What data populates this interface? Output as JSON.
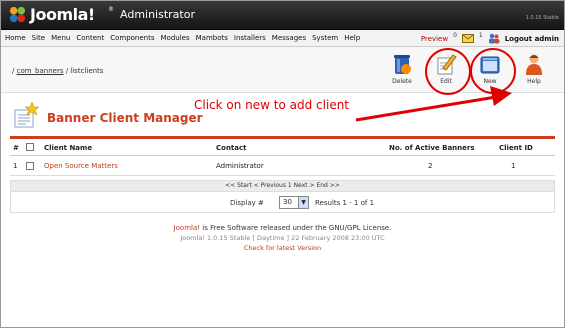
{
  "header": {
    "logo": "Joomla!",
    "logo_tm": "®",
    "title": "Administrator",
    "version": "1.0.15 Stable"
  },
  "menu": [
    "Home",
    "Site",
    "Menu",
    "Content",
    "Components",
    "Modules",
    "Mambots",
    "Installers",
    "Messages",
    "System",
    "Help"
  ],
  "status": {
    "preview": "Preview",
    "messages_count": "0",
    "users_count": "1",
    "logout": "Logout admin"
  },
  "breadcrumb": {
    "prefix": "/ ",
    "link": "com_banners",
    "rest": " / listclients"
  },
  "toolbar": {
    "delete": "Delete",
    "edit": "Edit",
    "new": "New",
    "help": "Help"
  },
  "page": {
    "title": "Banner Client Manager",
    "annotation": "Click on new to add client"
  },
  "table": {
    "headers": {
      "num": "#",
      "name": "Client Name",
      "contact": "Contact",
      "banners": "No. of Active Banners",
      "client_id": "Client ID"
    },
    "rows": [
      {
        "num": "1",
        "name": "Open Source Matters",
        "contact": "Administrator",
        "banners": "2",
        "client_id": "1"
      }
    ]
  },
  "pagination": {
    "nav": "<< Start < Previous 1 Next > End >>",
    "display_label": "Display #",
    "display_value": "30",
    "results": "Results 1 - 1 of 1"
  },
  "footer": {
    "joomla_link": "Joomla!",
    "license_text": " is Free Software released under the GNU/GPL License.",
    "version_line": "Joomla! 1.0.15 Stable [ Daytime ] 22 February 2008 23:00 UTC",
    "check_link": "Check for latest Version"
  },
  "colors": {
    "accent": "#d03c1f",
    "annotation": "#e00000"
  }
}
